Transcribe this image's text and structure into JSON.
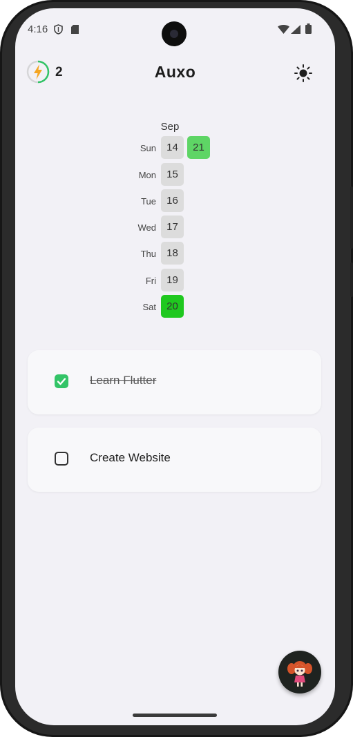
{
  "status_bar": {
    "time": "4:16",
    "icons": [
      "shield-icon",
      "sd-card-icon",
      "wifi-icon",
      "signal-icon",
      "battery-icon"
    ]
  },
  "app_bar": {
    "streak_icon": "lightning-ring-icon",
    "streak_count": "2",
    "title": "Auxo",
    "theme_icon": "sun-icon"
  },
  "calendar": {
    "month": "Sep",
    "days": [
      {
        "label": "Sun",
        "dates": [
          {
            "num": "14",
            "state": "empty"
          },
          {
            "num": "21",
            "state": "done"
          }
        ]
      },
      {
        "label": "Mon",
        "dates": [
          {
            "num": "15",
            "state": "empty"
          }
        ]
      },
      {
        "label": "Tue",
        "dates": [
          {
            "num": "16",
            "state": "empty"
          }
        ]
      },
      {
        "label": "Wed",
        "dates": [
          {
            "num": "17",
            "state": "empty"
          }
        ]
      },
      {
        "label": "Thu",
        "dates": [
          {
            "num": "18",
            "state": "empty"
          }
        ]
      },
      {
        "label": "Fri",
        "dates": [
          {
            "num": "19",
            "state": "empty"
          }
        ]
      },
      {
        "label": "Sat",
        "dates": [
          {
            "num": "20",
            "state": "full"
          }
        ]
      }
    ]
  },
  "tasks": [
    {
      "title": "Learn Flutter",
      "done": true
    },
    {
      "title": "Create Website",
      "done": false
    }
  ],
  "fab": {
    "icon": "mascot-avatar-icon"
  },
  "colors": {
    "accent_green": "#33c467",
    "cal_done": "#5ed565",
    "cal_full": "#1fc81f",
    "cal_empty": "#dcdcdc",
    "streak_bolt": "#f5a623",
    "background": "#f2f1f6"
  }
}
